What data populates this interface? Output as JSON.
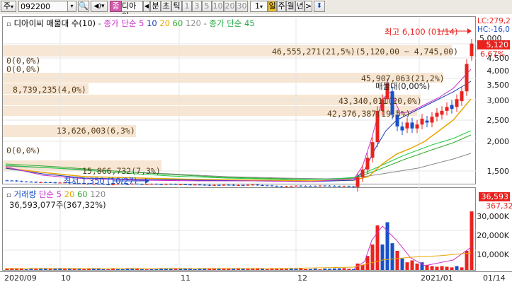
{
  "toolbar": {
    "market_label": "주",
    "code_value": "092200",
    "stock_name": "디아이",
    "star_label": "☆",
    "type_label": "종",
    "period_labels": [
      "분",
      "초",
      "틱",
      "1",
      "3",
      "5",
      "10",
      "20",
      "30"
    ],
    "interval_value": "1",
    "day_week_month": [
      "일",
      "주",
      "월",
      "년"
    ],
    "nav_next": ">"
  },
  "price_panel": {
    "legend_name": "디아이씨 매물대 수(10)",
    "legend_ma": "종가 단순 5",
    "legend_ma_periods": [
      "10",
      "20",
      "60",
      "120"
    ],
    "legend_ma2": "종가 단순 45",
    "lc_label": "LC:279,2",
    "hc_label": "HC:-16,0",
    "current_price": "5,120",
    "change_pct": "6,67%",
    "high_label": "최고 6,100 (01/14)",
    "low_label": "최저 1,350 (10/27)",
    "right_partial": "5,000",
    "y_ticks": [
      "4,500",
      "4,000",
      "3,500",
      "3,000",
      "2,500",
      "2,000",
      "1,500"
    ],
    "volume_profile": [
      {
        "text": "46,555,271(21,5%)(5,120,00 ~ 4,745,00)"
      },
      {
        "text": "0(0,0%)"
      },
      {
        "text": "0(0,0%)"
      },
      {
        "text": "45,907,063(21,2%)"
      },
      {
        "text": "8,739,235(4,0%)"
      },
      {
        "text": "매물대(0,00%)"
      },
      {
        "text": "43,340,011(20,0%)"
      },
      {
        "text": "42,376,387(19,5%)"
      },
      {
        "text": "13,626,003(6,3%)"
      },
      {
        "text": "0(0,0%)"
      },
      {
        "text": "15,866,732(7,3%)"
      }
    ]
  },
  "volume_panel": {
    "legend_name": "거래량",
    "legend_ma": "단순 5",
    "legend_ma_periods": [
      "20",
      "60",
      "120"
    ],
    "info_line": "36,593,077주(367,32%)",
    "badge_value": "36,593",
    "badge_pct": "367,32",
    "y_ticks": [
      "30,000K",
      "20,000K",
      "10,000K"
    ]
  },
  "x_axis": [
    "2020/09",
    "10",
    "11",
    "12",
    "2021/01",
    "01/14"
  ],
  "colors": {
    "up": "#e8231f",
    "down": "#1a50c8",
    "band": "#f6e6d3",
    "ma5": "#cc33cc",
    "ma20": "#e8a500",
    "ma60": "#33aa33",
    "ma120": "#666666"
  }
}
